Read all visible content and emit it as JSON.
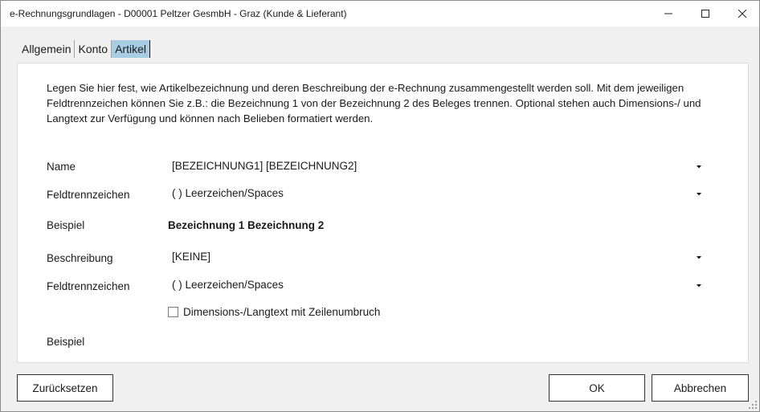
{
  "window": {
    "title": "e-Rechnungsgrundlagen - D00001 Peltzer GesmbH - Graz (Kunde & Lieferant)",
    "controls": {
      "minimize_icon": "minimize-icon",
      "maximize_icon": "maximize-icon",
      "close_icon": "close-icon"
    }
  },
  "tabs": [
    {
      "label": "Allgemein",
      "active": false
    },
    {
      "label": "Konto",
      "active": false
    },
    {
      "label": "Artikel",
      "active": true
    }
  ],
  "article": {
    "description": "Legen Sie hier fest, wie Artikelbezeichnung und deren Beschreibung der e-Rechnung zusammengestellt werden soll. Mit dem jeweiligen Feldtrennzeichen können Sie z.B.: die Bezeichnung 1 von der Bezeichnung 2 des Beleges trennen. Optional stehen auch Dimensions-/ und Langtext zur Verfügung und können nach Belieben formatiert werden.",
    "name_label": "Name",
    "name_value": "[BEZEICHNUNG1] [BEZEICHNUNG2]",
    "separator1_label": "Feldtrennzeichen",
    "separator1_value": "( ) Leerzeichen/Spaces",
    "example1_label": "Beispiel",
    "example1_value": "Bezeichnung 1 Bezeichnung 2",
    "description_label": "Beschreibung",
    "description_value": "[KEINE]",
    "separator2_label": "Feldtrennzeichen",
    "separator2_value": "( ) Leerzeichen/Spaces",
    "linebreak_checkbox_label": "Dimensions-/Langtext mit Zeilenumbruch",
    "linebreak_checked": false,
    "example2_label": "Beispiel",
    "example2_value": ""
  },
  "buttons": {
    "reset": "Zurücksetzen",
    "ok": "OK",
    "cancel": "Abbrechen"
  },
  "colors": {
    "active_tab": "#a6cde3",
    "dialog_background": "#f0f0f0",
    "panel_background": "#ffffff"
  }
}
